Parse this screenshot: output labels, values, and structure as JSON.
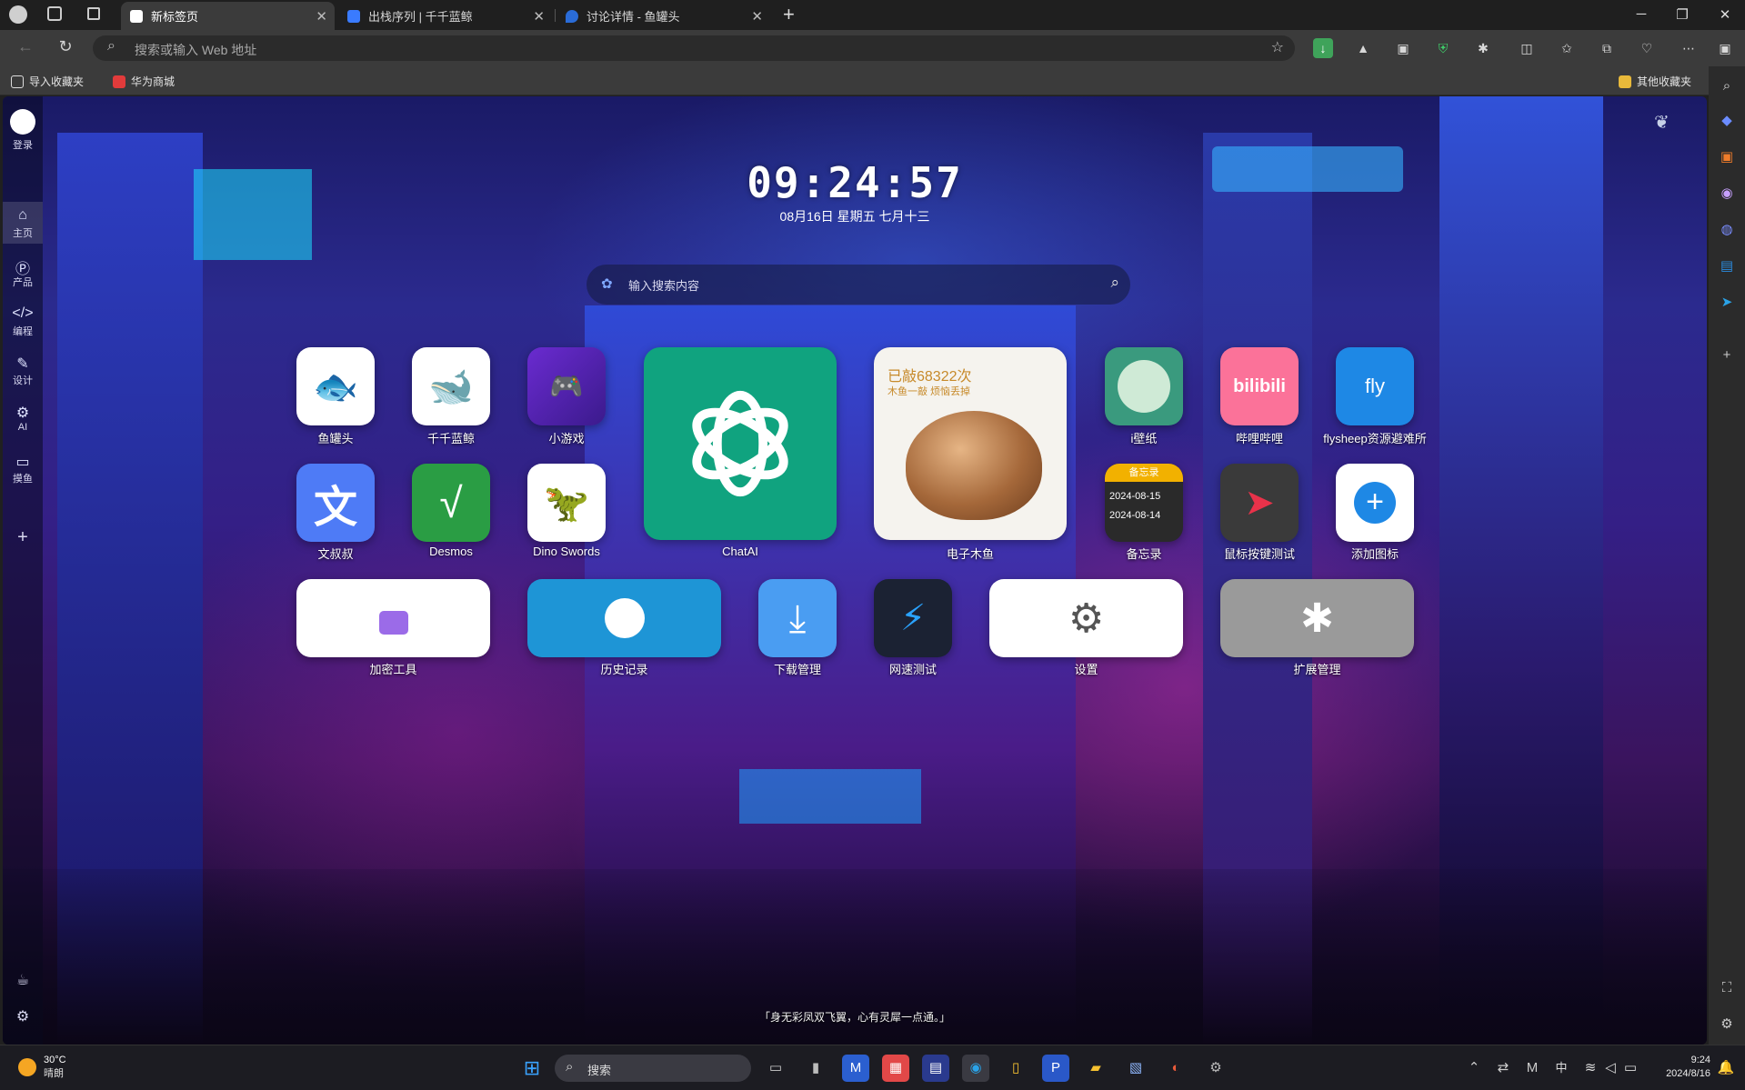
{
  "browser": {
    "tabs": [
      {
        "title": "新标签页",
        "active": true
      },
      {
        "title": "出栈序列 | 千千蓝鲸",
        "active": false
      },
      {
        "title": "讨论详情 - 鱼罐头",
        "active": false
      }
    ],
    "address_placeholder": "搜索或输入 Web 地址",
    "bookmarks": [
      "导入收藏夹",
      "华为商城"
    ],
    "other_bookmarks": "其他收藏夹"
  },
  "sidebar": {
    "login": "登录",
    "items": [
      "主页",
      "产品",
      "编程",
      "设计",
      "AI",
      "摸鱼"
    ]
  },
  "clock": {
    "time": "09:24:57",
    "date": "08月16日 星期五 七月十三"
  },
  "search": {
    "placeholder": "输入搜索内容"
  },
  "apps": {
    "yuguantou": "鱼罐头",
    "qianqian": "千千蓝鲸",
    "xiaoyouxi": "小游戏",
    "chatai": "ChatAI",
    "muyu": "电子木鱼",
    "muyu_count": "已敲68322次",
    "muyu_sub": "木鱼一敲 烦恼丢掉",
    "ibizhi": "i壁纸",
    "bilibili": "哔哩哔哩",
    "bilibili_logo": "bilibili",
    "fly": "flysheep资源避难所",
    "fly_logo": "fly",
    "wenshushu": "文叔叔",
    "wenshushu_glyph": "文",
    "desmos": "Desmos",
    "dino": "Dino Swords",
    "memo": "备忘录",
    "memo_header": "备忘录",
    "memo_dates": [
      "2024-08-15",
      "2024-08-14"
    ],
    "mouse_test": "鼠标按键测试",
    "add_icon": "添加图标",
    "encrypt": "加密工具",
    "history": "历史记录",
    "download": "下载管理",
    "speed": "网速测试",
    "settings": "设置",
    "extensions": "扩展管理"
  },
  "quote": "「身无彩凤双飞翼，心有灵犀一点通。」",
  "taskbar": {
    "weather_temp": "30°C",
    "weather_desc": "晴朗",
    "search": "搜索",
    "ime": "中",
    "time": "9:24",
    "date": "2024/8/16"
  }
}
